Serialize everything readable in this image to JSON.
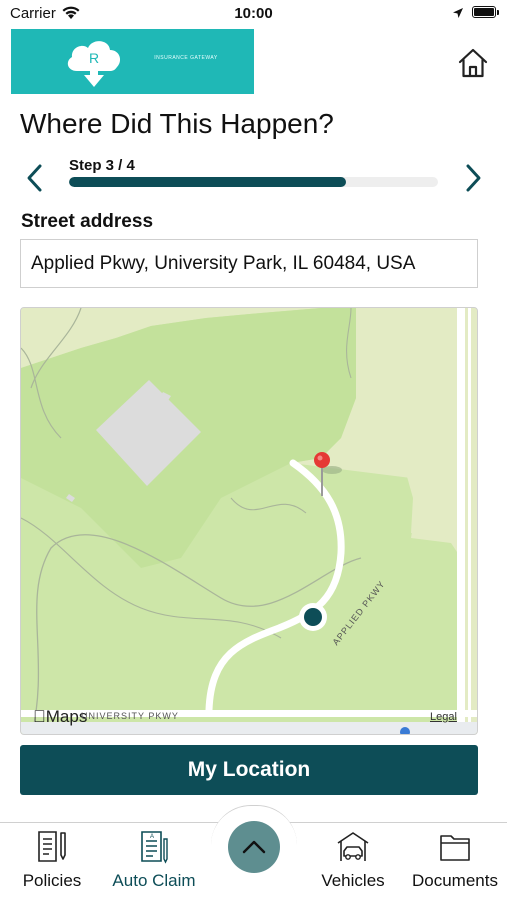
{
  "status_bar": {
    "carrier": "Carrier",
    "time": "10:00"
  },
  "header": {
    "logo_letter": "R",
    "logo_text": "INSURANCE GATEWAY"
  },
  "page": {
    "title": "Where Did This Happen?"
  },
  "stepper": {
    "label": "Step 3 / 4",
    "current": 3,
    "total": 4,
    "progress_fraction": 0.75
  },
  "street": {
    "label": "Street address",
    "value": "Applied Pkwy, University Park, IL 60484, USA"
  },
  "map": {
    "brand": "Maps",
    "legal": "Legal",
    "road_label_1": "APPLIED PKWY",
    "road_label_2": "UNIVERSITY PKWY"
  },
  "actions": {
    "my_location": "My Location"
  },
  "tabs": [
    {
      "label": "Policies",
      "icon": "policy-doc-icon",
      "active": false
    },
    {
      "label": "Auto Claim",
      "icon": "claim-doc-icon",
      "active": true
    },
    {
      "label": "Vehicles",
      "icon": "garage-car-icon",
      "active": false
    },
    {
      "label": "Documents",
      "icon": "folder-icon",
      "active": false
    }
  ],
  "colors": {
    "brand_teal": "#1fb8b6",
    "primary_dark": "#0d4d57",
    "center_button": "#5e8e90",
    "pin_red": "#e53935"
  }
}
